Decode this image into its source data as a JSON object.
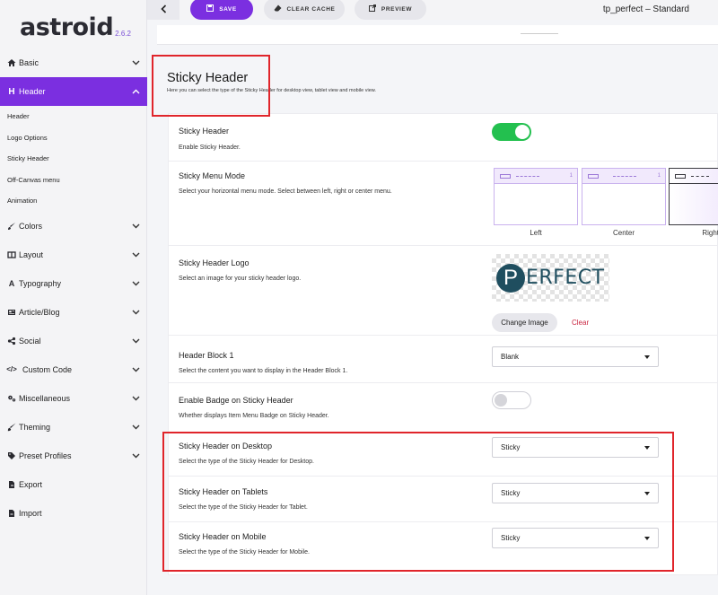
{
  "app": {
    "logo": "astroid",
    "version": "2.6.2"
  },
  "toolbar": {
    "save_label": "SAVE",
    "cache_label": "CLEAR CACHE",
    "preview_label": "PREVIEW",
    "template_name": "tp_perfect – Standard"
  },
  "sidebar": {
    "items": [
      {
        "label": "Basic",
        "icon": "home-icon"
      },
      {
        "label": "Header",
        "icon": "heading-icon"
      },
      {
        "label": "Colors",
        "icon": "brush-icon"
      },
      {
        "label": "Layout",
        "icon": "layout-icon"
      },
      {
        "label": "Typography",
        "icon": "font-icon"
      },
      {
        "label": "Article/Blog",
        "icon": "newspaper-icon"
      },
      {
        "label": "Social",
        "icon": "share-icon"
      },
      {
        "label": "Custom Code",
        "icon": "code-icon"
      },
      {
        "label": "Miscellaneous",
        "icon": "cogs-icon"
      },
      {
        "label": "Theming",
        "icon": "paint-brush-icon"
      },
      {
        "label": "Preset Profiles",
        "icon": "tag-icon"
      },
      {
        "label": "Export",
        "icon": "export-icon"
      },
      {
        "label": "Import",
        "icon": "import-icon"
      }
    ],
    "active": "Header",
    "sub_items": [
      "Header",
      "Logo Options",
      "Sticky Header",
      "Off-Canvas menu",
      "Animation"
    ]
  },
  "section": {
    "title": "Sticky Header",
    "description": "Here you can select the type of the Sticky Header for desktop view, tablet view and mobile view."
  },
  "fields": {
    "sticky_header": {
      "title": "Sticky Header",
      "desc": "Enable Sticky Header.",
      "enabled": true
    },
    "menu_mode": {
      "title": "Sticky Menu Mode",
      "desc": "Select your horizontal menu mode. Select between left, right or center menu.",
      "options": [
        "Left",
        "Center",
        "Right"
      ],
      "selected": "Right"
    },
    "logo": {
      "title": "Sticky Header Logo",
      "desc": "Select an image for your sticky header logo.",
      "logo_letter": "P",
      "logo_word": "ERFECT",
      "change_label": "Change Image",
      "clear_label": "Clear"
    },
    "block1": {
      "title": "Header Block 1",
      "desc": "Select the content you want to display in the Header Block 1.",
      "value": "Blank"
    },
    "badge": {
      "title": "Enable Badge on Sticky Header",
      "desc": "Whether displays Item Menu Badge on Sticky Header.",
      "enabled": false
    },
    "desktop": {
      "title": "Sticky Header on Desktop",
      "desc": "Select the type of the Sticky Header for Desktop.",
      "value": "Sticky"
    },
    "tablet": {
      "title": "Sticky Header on Tablets",
      "desc": "Select the type of the Sticky Header for Tablet.",
      "value": "Sticky"
    },
    "mobile": {
      "title": "Sticky Header on Mobile",
      "desc": "Select the type of the Sticky Header for Mobile.",
      "value": "Sticky"
    }
  },
  "colors": {
    "accent": "#7b2fe0",
    "toggle_on": "#23c04f",
    "highlight": "#e0252b",
    "clear_link": "#c9243f"
  }
}
